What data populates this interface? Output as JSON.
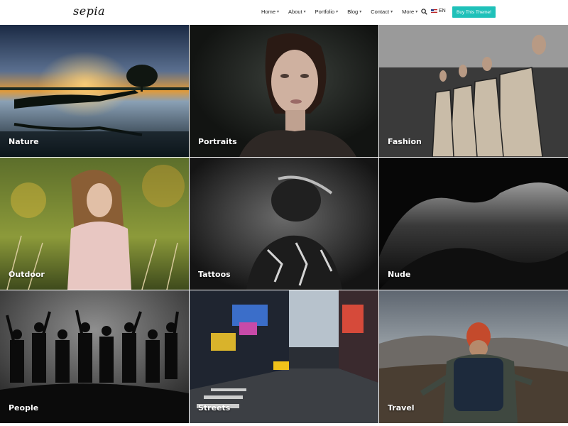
{
  "header": {
    "logo": "sepia",
    "nav": [
      {
        "label": "Home",
        "icon": "chevron-down-icon"
      },
      {
        "label": "About",
        "icon": "chevron-down-icon"
      },
      {
        "label": "Portfolio",
        "icon": "chevron-down-icon"
      },
      {
        "label": "Blog",
        "icon": "chevron-down-icon"
      },
      {
        "label": "Contact",
        "icon": "chevron-down-icon"
      },
      {
        "label": "More",
        "icon": "chevron-down-icon"
      }
    ],
    "search_icon": "search-icon",
    "language": {
      "flag_icon": "us-flag-icon",
      "label": "EN"
    },
    "buy_button": "Buy This Theme!",
    "accent_color": "#1fc1b9"
  },
  "gallery": {
    "tiles": [
      {
        "label": "Nature"
      },
      {
        "label": "Portraits"
      },
      {
        "label": "Fashion"
      },
      {
        "label": "Outdoor"
      },
      {
        "label": "Tattoos"
      },
      {
        "label": "Nude"
      },
      {
        "label": "People"
      },
      {
        "label": "Streets"
      },
      {
        "label": "Travel"
      }
    ]
  }
}
